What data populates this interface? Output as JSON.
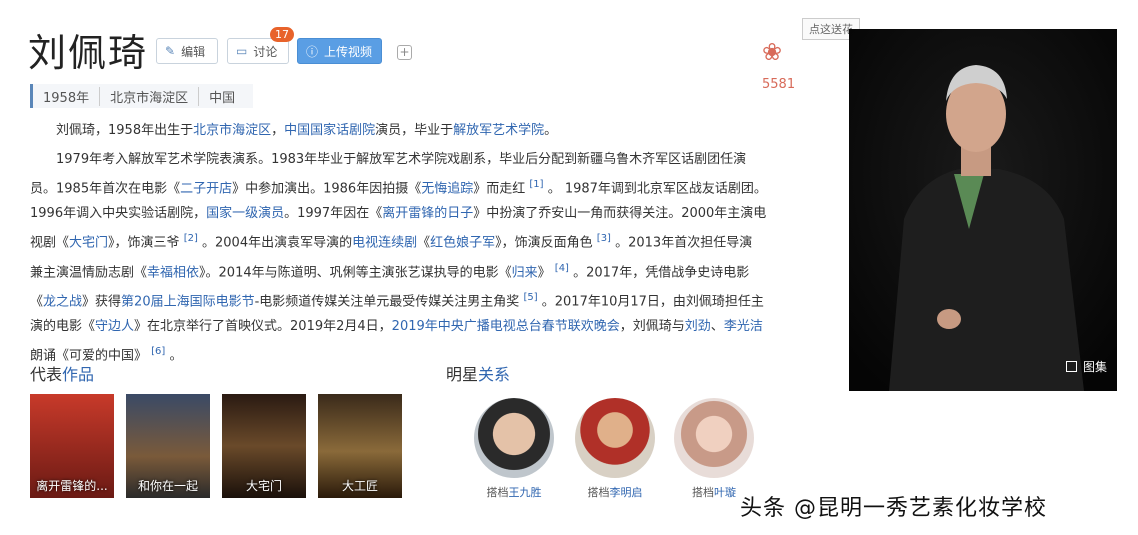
{
  "person": {
    "name": "刘佩琦",
    "meta": [
      "1958年",
      "北京市海淀区",
      "中国"
    ]
  },
  "toolbar": {
    "edit_label": "编辑",
    "discuss_label": "讨论",
    "discuss_count": "17",
    "upload_label": "上传视频",
    "plus_label": "+"
  },
  "flower": {
    "tooltip": "点这送花",
    "count": "5581"
  },
  "intro": {
    "p1": {
      "t1": "刘佩琦，1958年出生于",
      "l1": "北京市海淀区",
      "t2": "，",
      "l2": "中国国家话剧院",
      "t3": "演员，毕业于",
      "l3": "解放军艺术学院",
      "t4": "。"
    },
    "p2": {
      "line1": "1979年考入解放军艺术学院表演系。1983年毕业于解放军艺术学院戏剧系，毕业后分配到新疆乌鲁木齐军区话剧团任演",
      "line2_a": "员。1985年首次在电影《",
      "line2_l1": "二子开店",
      "line2_b": "》中参加演出。1986年因拍摄《",
      "line2_l2": "无悔追踪",
      "line2_c": "》而走红",
      "ref1": "[1]",
      "line2_d": "。 1987年调到北京军区战友话剧团。",
      "line3_a": "1996年调入中央实验话剧院，",
      "line3_l1": "国家一级演员",
      "line3_b": "。1997年因在《",
      "line3_l2": "离开雷锋的日子",
      "line3_c": "》中扮演了乔安山一角而获得关注。2000年主演电",
      "line4_a": "视剧《",
      "line4_l1": "大宅门",
      "line4_b": "》，饰演三爷",
      "ref2": "[2]",
      "line4_c": "。2004年出演袁军导演的",
      "line4_l2": "电视连续剧",
      "line4_d": "《",
      "line4_l3": "红色娘子军",
      "line4_e": "》，饰演反面角色",
      "ref3": "[3]",
      "line4_f": "。2013年首次担任导演",
      "line5_a": "兼主演温情励志剧《",
      "line5_l1": "幸福相依",
      "line5_b": "》。2014年与陈道明、巩俐等主演张艺谋执导的电影《",
      "line5_l2": "归来",
      "line5_c": "》",
      "ref4": "[4]",
      "line5_d": "。2017年，凭借战争史诗电影",
      "line6_a": "《",
      "line6_l1": "龙之战",
      "line6_b": "》获得",
      "line6_l2": "第20届上海国际电影节",
      "line6_c": "-电影频道传媒关注单元最受传媒关注男主角奖",
      "ref5": "[5]",
      "line6_d": "。2017年10月17日，由刘佩琦担任主",
      "line7_a": "演的电影《",
      "line7_l1": "守边人",
      "line7_b": "》在北京举行了首映仪式。2019年2月4日，",
      "line7_l2": "2019年中央广播电视总台春节联欢晚会",
      "line7_c": "，刘佩琦与",
      "line7_l3": "刘劲",
      "line7_d": "、",
      "line7_l4": "李光洁",
      "line8_a": "朗诵《可爱的中国》",
      "ref6": "[6]",
      "line8_b": "。"
    }
  },
  "works": {
    "title_a": "代表",
    "title_b": "作品",
    "items": [
      {
        "caption": "离开雷锋的..."
      },
      {
        "caption": "和你在一起"
      },
      {
        "caption": "大宅门"
      },
      {
        "caption": "大工匠"
      }
    ]
  },
  "relations": {
    "title_a": "明星",
    "title_b": "关系",
    "items": [
      {
        "prefix": "搭档",
        "name": "王九胜"
      },
      {
        "prefix": "搭档",
        "name": "李明启"
      },
      {
        "prefix": "搭档",
        "name": "叶璇"
      }
    ]
  },
  "gallery_label": "图集",
  "watermark": "头条 @昆明一秀艺素化妆学校",
  "colors": {
    "link": "#3066b0",
    "accent": "#5a86b8",
    "badge": "#e8632b",
    "flower": "#d86b5a"
  }
}
